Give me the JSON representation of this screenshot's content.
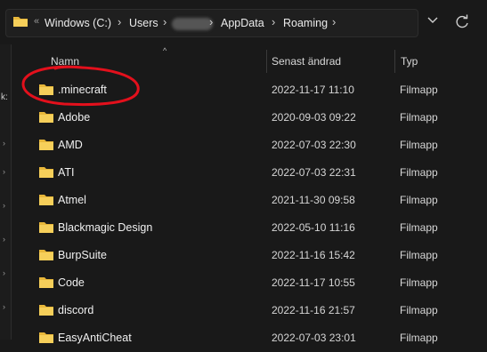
{
  "address": {
    "overflow": "«",
    "crumbs": [
      "Windows (C:)",
      "Users",
      "AppData",
      "Roaming"
    ],
    "separator": "›"
  },
  "icons": {
    "folder": "folder-icon",
    "refresh": "refresh-icon",
    "chevron": "chevron-down-icon"
  },
  "left_pane": {
    "text": "k:"
  },
  "columns": {
    "name": "Namn",
    "date": "Senast ändrad",
    "type": "Typ"
  },
  "rows": [
    {
      "name": ".minecraft",
      "date": "2022-11-17 11:10",
      "type": "Filmapp"
    },
    {
      "name": "Adobe",
      "date": "2020-09-03 09:22",
      "type": "Filmapp"
    },
    {
      "name": "AMD",
      "date": "2022-07-03 22:30",
      "type": "Filmapp"
    },
    {
      "name": "ATI",
      "date": "2022-07-03 22:31",
      "type": "Filmapp"
    },
    {
      "name": "Atmel",
      "date": "2021-11-30 09:58",
      "type": "Filmapp"
    },
    {
      "name": "Blackmagic Design",
      "date": "2022-05-10 11:16",
      "type": "Filmapp"
    },
    {
      "name": "BurpSuite",
      "date": "2022-11-16 15:42",
      "type": "Filmapp"
    },
    {
      "name": "Code",
      "date": "2022-11-17 10:55",
      "type": "Filmapp"
    },
    {
      "name": "discord",
      "date": "2022-11-16 21:57",
      "type": "Filmapp"
    },
    {
      "name": "EasyAntiCheat",
      "date": "2022-07-03 23:01",
      "type": "Filmapp"
    }
  ],
  "colors": {
    "folder": "#f4c84c",
    "annotation": "#e3101c"
  }
}
